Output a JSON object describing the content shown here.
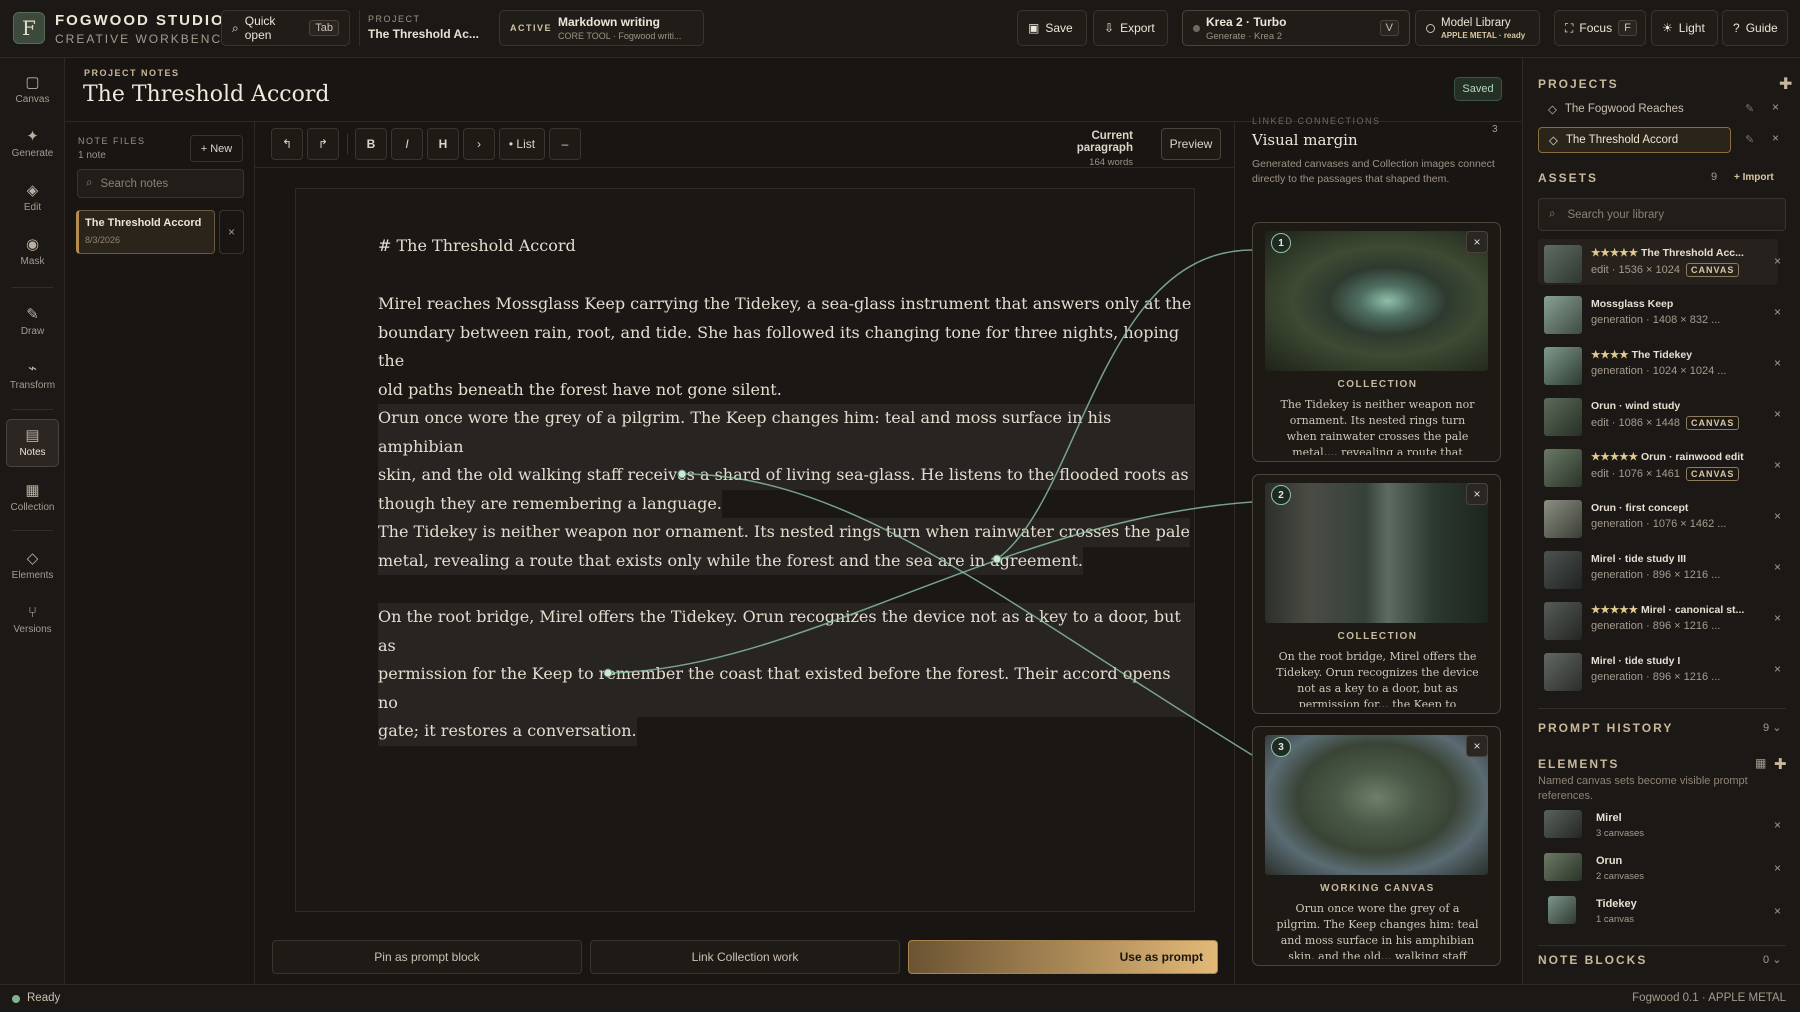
{
  "brand": {
    "name": "FOGWOOD STUDIO",
    "subtitle": "CREATIVE WORKBENCH",
    "logo_letter": "F"
  },
  "topbar": {
    "quick_open": "Quick open",
    "quick_open_key": "Tab",
    "project_label": "PROJECT",
    "project_name": "The Threshold Ac...",
    "active_label": "ACTIVE",
    "active_title": "Markdown writing",
    "active_sub": "CORE TOOL · Fogwood writi...",
    "save": "Save",
    "export": "Export",
    "model_name": "Krea 2 · Turbo",
    "model_sub": "Generate · Krea 2",
    "model_key": "V",
    "library_title": "Model Library",
    "library_sub": "APPLE METAL · ready",
    "focus": "Focus",
    "focus_key": "F",
    "light": "Light",
    "guide": "Guide"
  },
  "sidebar": [
    "Canvas",
    "Generate",
    "Edit",
    "Mask",
    "Draw",
    "Transform",
    "Notes",
    "Collection",
    "Elements",
    "Versions"
  ],
  "notes_header": {
    "label": "PROJECT NOTES",
    "title": "The Threshold Accord",
    "status": "Saved"
  },
  "files": {
    "label": "NOTE FILES",
    "count": "1 note",
    "new_button": "+ New",
    "search_placeholder": "Search notes",
    "items": [
      {
        "title": "The Threshold Accord",
        "date": "8/3/2026"
      }
    ]
  },
  "toolbar": {
    "bold": "B",
    "italic": "I",
    "heading": "H",
    "list": "• List",
    "scope_title": "Current paragraph",
    "scope_words": "164 words",
    "preview": "Preview"
  },
  "document": {
    "heading": "# The Threshold Accord",
    "paragraphs": [
      [
        "Mirel reaches Mossglass Keep carrying the Tidekey, a sea-glass instrument that answers only at the",
        "boundary between rain, root, and tide. She has followed its changing tone for three nights, hoping the",
        "old paths beneath the forest have not gone silent."
      ],
      [
        "Orun once wore the grey of a pilgrim. The Keep changes him: teal and moss surface in his amphibian",
        "skin, and the old walking staff receives a shard of living sea-glass. He listens to the flooded roots as",
        "though they are remembering a language."
      ],
      [
        "The Tidekey is neither weapon nor ornament. Its nested rings turn when rainwater crosses the pale",
        "metal, revealing a route that exists only while the forest and the sea are in agreement."
      ],
      [
        "On the root bridge, Mirel offers the Tidekey. Orun recognizes the device not as a key to a door, but as",
        "permission for the Keep to remember the coast that existed before the forest. Their accord opens no",
        "gate; it restores a conversation."
      ]
    ]
  },
  "actions": {
    "pin": "Pin as prompt block",
    "link": "Link Collection work",
    "use": "Use as prompt"
  },
  "margin": {
    "kicker": "LINKED CONNECTIONS",
    "title": "Visual margin",
    "count": "3",
    "desc": "Generated canvases and Collection images connect directly to the passages that shaped them.",
    "cards": [
      {
        "num": "1",
        "type": "COLLECTION",
        "text": "The Tidekey is neither weapon nor ornament. Its nested rings turn when rainwater crosses the pale metal,... revealing a route that exists only while"
      },
      {
        "num": "2",
        "type": "COLLECTION",
        "text": "On the root bridge, Mirel offers the Tidekey. Orun recognizes the device not as a key to a door, but as permission for... the Keep to remember the coast that"
      },
      {
        "num": "3",
        "type": "WORKING CANVAS",
        "text": "Orun once wore the grey of a pilgrim. The Keep changes him: teal and moss surface in his amphibian skin, and the old... walking staff receives a shard of living"
      }
    ]
  },
  "projects": {
    "title": "PROJECTS",
    "items": [
      "The Fogwood Reaches",
      "The Threshold Accord"
    ]
  },
  "assets": {
    "title": "ASSETS",
    "count": "9",
    "import": "+ Import",
    "search_placeholder": "Search your library",
    "items": [
      {
        "stars": "★★★★★",
        "name": "The Threshold Acc...",
        "meta": "edit · 1536 × 1024",
        "badge": "CANVAS"
      },
      {
        "stars": "",
        "name": "Mossglass Keep",
        "meta": "generation · 1408 × 832 ...",
        "badge": ""
      },
      {
        "stars": "★★★★",
        "name": "The Tidekey",
        "meta": "generation · 1024 × 1024 ...",
        "badge": ""
      },
      {
        "stars": "",
        "name": "Orun · wind study",
        "meta": "edit · 1086 × 1448",
        "badge": "CANVAS"
      },
      {
        "stars": "★★★★★",
        "name": "Orun · rainwood edit",
        "meta": "edit · 1076 × 1461",
        "badge": "CANVAS"
      },
      {
        "stars": "",
        "name": "Orun · first concept",
        "meta": "generation · 1076 × 1462 ...",
        "badge": ""
      },
      {
        "stars": "",
        "name": "Mirel · tide study III",
        "meta": "generation · 896 × 1216 ...",
        "badge": ""
      },
      {
        "stars": "★★★★★",
        "name": "Mirel · canonical st...",
        "meta": "generation · 896 × 1216 ...",
        "badge": ""
      },
      {
        "stars": "",
        "name": "Mirel · tide study I",
        "meta": "generation · 896 × 1216 ...",
        "badge": ""
      }
    ]
  },
  "prompt_history": {
    "title": "PROMPT HISTORY",
    "count": "9"
  },
  "elements": {
    "title": "ELEMENTS",
    "desc": "Named canvas sets become visible prompt references.",
    "items": [
      {
        "name": "Mirel",
        "count": "3 canvases"
      },
      {
        "name": "Orun",
        "count": "2 canvases"
      },
      {
        "name": "Tidekey",
        "count": "1 canvas"
      }
    ]
  },
  "note_blocks": {
    "title": "NOTE BLOCKS",
    "count": "0"
  },
  "status": {
    "left": "Ready",
    "right": "Fogwood 0.1 · APPLE METAL"
  }
}
